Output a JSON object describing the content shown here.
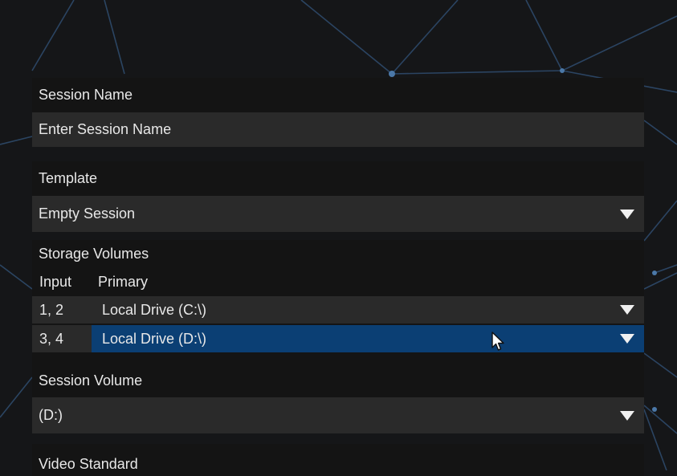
{
  "session_name": {
    "label": "Session Name",
    "placeholder": "Enter Session Name"
  },
  "template": {
    "label": "Template",
    "value": "Empty Session"
  },
  "storage_volumes": {
    "label": "Storage Volumes",
    "columns": [
      "Input",
      "Primary"
    ],
    "rows": [
      {
        "input": "1, 2",
        "primary": "Local Drive (C:\\)"
      },
      {
        "input": "3, 4",
        "primary": "Local Drive (D:\\)"
      }
    ]
  },
  "session_volume": {
    "label": "Session Volume",
    "value": "(D:)"
  },
  "video_standard": {
    "label": "Video Standard"
  },
  "colors": {
    "background": "#151618",
    "header": "#141414",
    "field": "#2a2a2a",
    "selected_row": "#0b3f74",
    "network_lines": "#3b5f86"
  }
}
